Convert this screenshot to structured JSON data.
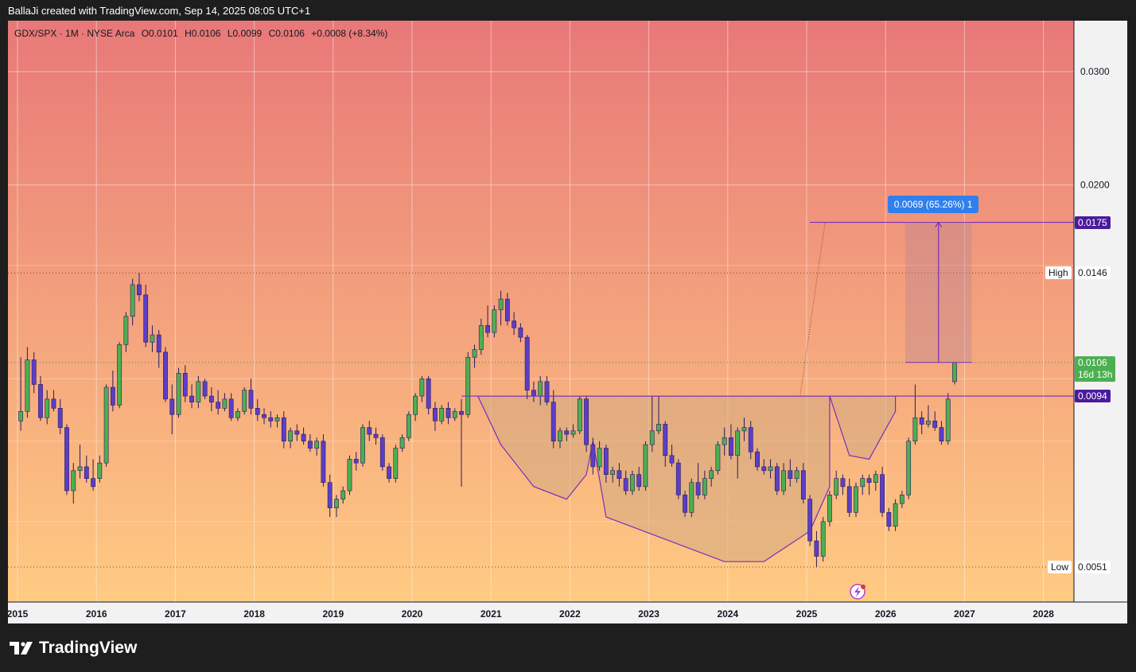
{
  "header": {
    "attribution": "BallaJi created with TradingView.com, Sep 14, 2025 08:05 UTC+1"
  },
  "legend": {
    "symbol": "GDX/SPX · 1M · NYSE Arca",
    "open": "O0.0101",
    "high": "H0.0106",
    "low": "L0.0099",
    "close": "C0.0106",
    "change": "+0.0008 (+8.34%)"
  },
  "footer": {
    "brand": "TradingView"
  },
  "colors": {
    "bull": "#4caf50",
    "bear": "#5b3ec8",
    "drawing": "#7b2cbf",
    "level_tag": "#4b1a9e",
    "last_price": "#4caf50",
    "measure": "#2f80ed",
    "gradient_top": "#e87878",
    "gradient_bottom": "#ffcb82"
  },
  "chart_data": {
    "type": "candlestick",
    "scale": "log",
    "ylim": [
      0.0045,
      0.036
    ],
    "xlim": [
      "2015-01",
      "2028-12"
    ],
    "y_ticks": [
      0.03,
      0.02
    ],
    "x_ticks": [
      "2015",
      "2016",
      "2017",
      "2018",
      "2019",
      "2020",
      "2021",
      "2022",
      "2023",
      "2024",
      "2025",
      "2026",
      "2027",
      "2028"
    ],
    "grid": true,
    "axis_side": "right",
    "price_labels": {
      "target": "0.0175",
      "high_label": "High",
      "high_value": "0.0146",
      "last": "0.0106",
      "countdown": "16d 13h",
      "neckline": "0.0094",
      "low_label": "Low",
      "low_value": "0.0051"
    },
    "measure_label": "0.0069 (65.26%) 1",
    "levels": {
      "target": 0.0175,
      "high": 0.0146,
      "last": 0.0106,
      "neckline": 0.0094,
      "low": 0.0051
    },
    "pattern": "cup and handle / inverse head and shoulders",
    "series": [
      {
        "description": "GDX/SPX monthly candles [open, high, low, close], Jan 2015 – Sep 2025 (approximate)",
        "start": "2015-01",
        "ohlc": [
          [
            0.0086,
            0.0108,
            0.0083,
            0.0089
          ],
          [
            0.0089,
            0.0112,
            0.0087,
            0.0107
          ],
          [
            0.0107,
            0.011,
            0.0095,
            0.0098
          ],
          [
            0.0098,
            0.0101,
            0.0086,
            0.0087
          ],
          [
            0.0087,
            0.0096,
            0.0085,
            0.0093
          ],
          [
            0.0093,
            0.0096,
            0.0089,
            0.009
          ],
          [
            0.009,
            0.0093,
            0.0082,
            0.0084
          ],
          [
            0.0084,
            0.0085,
            0.0066,
            0.0067
          ],
          [
            0.0067,
            0.0074,
            0.0064,
            0.0072
          ],
          [
            0.0072,
            0.0079,
            0.007,
            0.0073
          ],
          [
            0.0073,
            0.0076,
            0.0069,
            0.007
          ],
          [
            0.007,
            0.0075,
            0.0067,
            0.0068
          ],
          [
            0.007,
            0.0076,
            0.0069,
            0.0074
          ],
          [
            0.0074,
            0.0098,
            0.0073,
            0.0097
          ],
          [
            0.0097,
            0.0103,
            0.0089,
            0.0091
          ],
          [
            0.0091,
            0.0114,
            0.009,
            0.0113
          ],
          [
            0.0113,
            0.0127,
            0.011,
            0.0125
          ],
          [
            0.0125,
            0.0143,
            0.0121,
            0.014
          ],
          [
            0.014,
            0.0146,
            0.0132,
            0.0135
          ],
          [
            0.0135,
            0.014,
            0.0112,
            0.0114
          ],
          [
            0.0114,
            0.0121,
            0.011,
            0.0117
          ],
          [
            0.0117,
            0.0119,
            0.0104,
            0.011
          ],
          [
            0.011,
            0.0112,
            0.0092,
            0.0093
          ],
          [
            0.0093,
            0.0098,
            0.0082,
            0.0088
          ],
          [
            0.0088,
            0.0104,
            0.0087,
            0.0102
          ],
          [
            0.0102,
            0.0105,
            0.0092,
            0.0094
          ],
          [
            0.0094,
            0.0098,
            0.009,
            0.0092
          ],
          [
            0.0092,
            0.0101,
            0.009,
            0.0099
          ],
          [
            0.0099,
            0.01,
            0.0093,
            0.0094
          ],
          [
            0.0094,
            0.0097,
            0.0089,
            0.0092
          ],
          [
            0.0092,
            0.0096,
            0.0088,
            0.009
          ],
          [
            0.009,
            0.0095,
            0.0089,
            0.0093
          ],
          [
            0.0093,
            0.0095,
            0.0086,
            0.0087
          ],
          [
            0.0087,
            0.009,
            0.0086,
            0.0089
          ],
          [
            0.0089,
            0.0097,
            0.0088,
            0.0096
          ],
          [
            0.0096,
            0.01,
            0.0088,
            0.009
          ],
          [
            0.009,
            0.0093,
            0.0086,
            0.0088
          ],
          [
            0.0088,
            0.009,
            0.0085,
            0.0087
          ],
          [
            0.0087,
            0.0089,
            0.0084,
            0.0086
          ],
          [
            0.0086,
            0.0088,
            0.0084,
            0.0087
          ],
          [
            0.0087,
            0.0089,
            0.0078,
            0.008
          ],
          [
            0.008,
            0.0084,
            0.0078,
            0.0083
          ],
          [
            0.0083,
            0.0085,
            0.008,
            0.0082
          ],
          [
            0.0082,
            0.0084,
            0.0079,
            0.008
          ],
          [
            0.008,
            0.0082,
            0.0077,
            0.0078
          ],
          [
            0.0078,
            0.0081,
            0.0076,
            0.008
          ],
          [
            0.008,
            0.0082,
            0.0068,
            0.0069
          ],
          [
            0.0069,
            0.0071,
            0.0061,
            0.0063
          ],
          [
            0.0063,
            0.0066,
            0.0061,
            0.0065
          ],
          [
            0.0065,
            0.0068,
            0.0064,
            0.0067
          ],
          [
            0.0067,
            0.0076,
            0.0066,
            0.0075
          ],
          [
            0.0075,
            0.0077,
            0.0072,
            0.0074
          ],
          [
            0.0074,
            0.0085,
            0.0073,
            0.0084
          ],
          [
            0.0084,
            0.0086,
            0.008,
            0.0082
          ],
          [
            0.0082,
            0.0084,
            0.0079,
            0.0081
          ],
          [
            0.0081,
            0.0082,
            0.0072,
            0.0073
          ],
          [
            0.0073,
            0.0074,
            0.0069,
            0.007
          ],
          [
            0.007,
            0.0079,
            0.0069,
            0.0078
          ],
          [
            0.0078,
            0.0082,
            0.0077,
            0.0081
          ],
          [
            0.0081,
            0.0089,
            0.008,
            0.0088
          ],
          [
            0.0088,
            0.0095,
            0.0086,
            0.0094
          ],
          [
            0.0094,
            0.0101,
            0.0092,
            0.01
          ],
          [
            0.01,
            0.0101,
            0.0088,
            0.009
          ],
          [
            0.009,
            0.0092,
            0.0083,
            0.0086
          ],
          [
            0.0086,
            0.0091,
            0.0085,
            0.009
          ],
          [
            0.009,
            0.0092,
            0.0085,
            0.0087
          ],
          [
            0.0087,
            0.009,
            0.0086,
            0.0089
          ],
          [
            0.0089,
            0.0093,
            0.0068,
            0.0088
          ],
          [
            0.0088,
            0.011,
            0.0087,
            0.0108
          ],
          [
            0.0108,
            0.0113,
            0.0104,
            0.0111
          ],
          [
            0.0111,
            0.0124,
            0.0109,
            0.0121
          ],
          [
            0.0121,
            0.013,
            0.0116,
            0.0118
          ],
          [
            0.0118,
            0.013,
            0.0116,
            0.0128
          ],
          [
            0.0128,
            0.0137,
            0.0121,
            0.0133
          ],
          [
            0.0133,
            0.0136,
            0.0121,
            0.0123
          ],
          [
            0.0123,
            0.0127,
            0.0117,
            0.012
          ],
          [
            0.012,
            0.0122,
            0.0114,
            0.0116
          ],
          [
            0.0116,
            0.0117,
            0.0093,
            0.0096
          ],
          [
            0.0096,
            0.0099,
            0.0092,
            0.0094
          ],
          [
            0.0094,
            0.0101,
            0.0091,
            0.0099
          ],
          [
            0.0099,
            0.0101,
            0.0091,
            0.0092
          ],
          [
            0.0092,
            0.0096,
            0.0078,
            0.008
          ],
          [
            0.008,
            0.0084,
            0.0078,
            0.0083
          ],
          [
            0.0083,
            0.0084,
            0.008,
            0.0082
          ],
          [
            0.0082,
            0.0085,
            0.0081,
            0.0083
          ],
          [
            0.0083,
            0.0094,
            0.0082,
            0.0093
          ],
          [
            0.0093,
            0.0094,
            0.0077,
            0.0079
          ],
          [
            0.0079,
            0.0081,
            0.0071,
            0.0073
          ],
          [
            0.0073,
            0.008,
            0.0072,
            0.0078
          ],
          [
            0.0078,
            0.0079,
            0.0069,
            0.0071
          ],
          [
            0.0071,
            0.0073,
            0.0069,
            0.0072
          ],
          [
            0.0072,
            0.0074,
            0.0068,
            0.007
          ],
          [
            0.007,
            0.0072,
            0.0066,
            0.0067
          ],
          [
            0.0067,
            0.0072,
            0.0066,
            0.0071
          ],
          [
            0.0071,
            0.0073,
            0.0067,
            0.0068
          ],
          [
            0.0068,
            0.008,
            0.0067,
            0.0079
          ],
          [
            0.0079,
            0.0094,
            0.0077,
            0.0083
          ],
          [
            0.0083,
            0.0094,
            0.0082,
            0.0085
          ],
          [
            0.0085,
            0.0086,
            0.0073,
            0.0076
          ],
          [
            0.0076,
            0.0079,
            0.0073,
            0.0074
          ],
          [
            0.0074,
            0.0075,
            0.0065,
            0.0066
          ],
          [
            0.0066,
            0.0067,
            0.0061,
            0.0062
          ],
          [
            0.0062,
            0.007,
            0.0061,
            0.0069
          ],
          [
            0.0069,
            0.0074,
            0.0065,
            0.0066
          ],
          [
            0.0066,
            0.0072,
            0.0065,
            0.007
          ],
          [
            0.007,
            0.0073,
            0.0068,
            0.0072
          ],
          [
            0.0072,
            0.008,
            0.0071,
            0.0079
          ],
          [
            0.0079,
            0.0084,
            0.0076,
            0.0081
          ],
          [
            0.0081,
            0.0085,
            0.0075,
            0.0076
          ],
          [
            0.0076,
            0.0084,
            0.007,
            0.0083
          ],
          [
            0.0083,
            0.0087,
            0.008,
            0.0084
          ],
          [
            0.0084,
            0.0086,
            0.0075,
            0.0077
          ],
          [
            0.0077,
            0.0078,
            0.0072,
            0.0073
          ],
          [
            0.0073,
            0.0075,
            0.0071,
            0.0072
          ],
          [
            0.0072,
            0.0075,
            0.007,
            0.0073
          ],
          [
            0.0073,
            0.0074,
            0.0066,
            0.0067
          ],
          [
            0.0067,
            0.0074,
            0.0066,
            0.0072
          ],
          [
            0.0072,
            0.0075,
            0.0068,
            0.007
          ],
          [
            0.007,
            0.0073,
            0.0069,
            0.0072
          ],
          [
            0.0072,
            0.0074,
            0.0064,
            0.0065
          ],
          [
            0.0065,
            0.0066,
            0.0055,
            0.0056
          ],
          [
            0.0056,
            0.0058,
            0.0051,
            0.0053
          ],
          [
            0.0053,
            0.0061,
            0.0052,
            0.006
          ],
          [
            0.006,
            0.0067,
            0.0059,
            0.0066
          ],
          [
            0.0066,
            0.0072,
            0.0065,
            0.007
          ],
          [
            0.007,
            0.0071,
            0.0066,
            0.0068
          ],
          [
            0.0068,
            0.007,
            0.0061,
            0.0062
          ],
          [
            0.0062,
            0.0069,
            0.0061,
            0.0068
          ],
          [
            0.0068,
            0.0071,
            0.0066,
            0.007
          ],
          [
            0.007,
            0.0071,
            0.0066,
            0.0069
          ],
          [
            0.0069,
            0.0072,
            0.0067,
            0.0071
          ],
          [
            0.0071,
            0.0073,
            0.0061,
            0.0062
          ],
          [
            0.0062,
            0.0063,
            0.0058,
            0.0059
          ],
          [
            0.0059,
            0.0065,
            0.0058,
            0.0064
          ],
          [
            0.0064,
            0.0067,
            0.0063,
            0.0066
          ],
          [
            0.0066,
            0.0081,
            0.0065,
            0.008
          ],
          [
            0.008,
            0.0098,
            0.0079,
            0.0087
          ],
          [
            0.0087,
            0.0089,
            0.0082,
            0.0085
          ],
          [
            0.0085,
            0.0091,
            0.0084,
            0.0086
          ],
          [
            0.0086,
            0.0089,
            0.0083,
            0.0084
          ],
          [
            0.0084,
            0.0086,
            0.0079,
            0.008
          ],
          [
            0.008,
            0.0095,
            0.0079,
            0.0093
          ],
          [
            0.0099,
            0.0106,
            0.0098,
            0.0106
          ]
        ]
      }
    ]
  }
}
